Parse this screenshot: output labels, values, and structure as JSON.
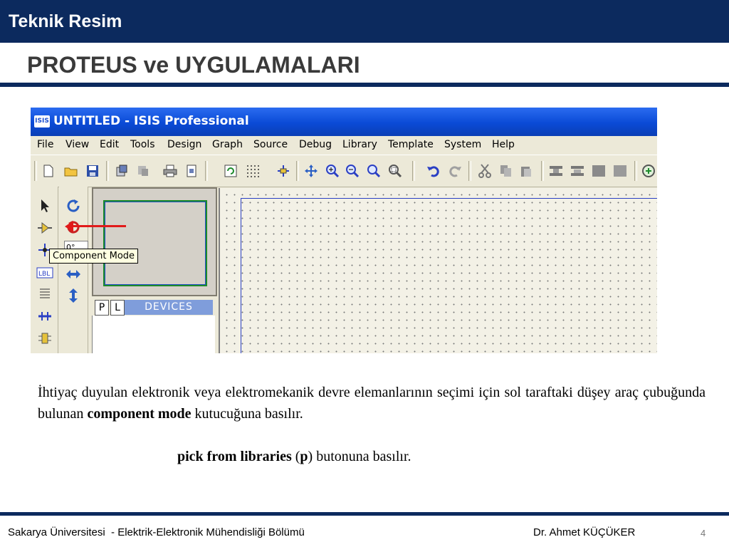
{
  "header": {
    "course": "Teknik Resim",
    "title": "PROTEUS ve UYGULAMALARI"
  },
  "screenshot": {
    "logo": "ISIS",
    "window_title": "UNTITLED - ISIS Professional",
    "menu": [
      "File",
      "View",
      "Edit",
      "Tools",
      "Design",
      "Graph",
      "Source",
      "Debug",
      "Library",
      "Template",
      "System",
      "Help"
    ],
    "tooltip": "Component Mode",
    "rotation": "0°",
    "selector": {
      "p": "P",
      "l": "L",
      "devices": "DEVICES"
    }
  },
  "body": {
    "para1": "İhtiyaç duyulan elektronik veya elektromekanik devre elemanlarının seçimi için sol taraftaki düşey araç çubuğunda bulunan ",
    "para1_bold": "component mode",
    "para1_end": " kutucuğuna basılır.",
    "para2_bold": "pick from libraries",
    "para2_paren_open": " (",
    "para2_p": "p",
    "para2_end": ") butonuna basılır."
  },
  "footer": {
    "left": "Sakarya Üniversitesi  - Elektrik-Elektronik Mühendisliği Bölümü",
    "author": "Dr. Ahmet KÜÇÜKER",
    "page": "4"
  },
  "colors": {
    "brand_navy": "#0c2a5e",
    "xp_title_blue": "#0a4ad6",
    "highlight_red": "#e11a1a"
  }
}
